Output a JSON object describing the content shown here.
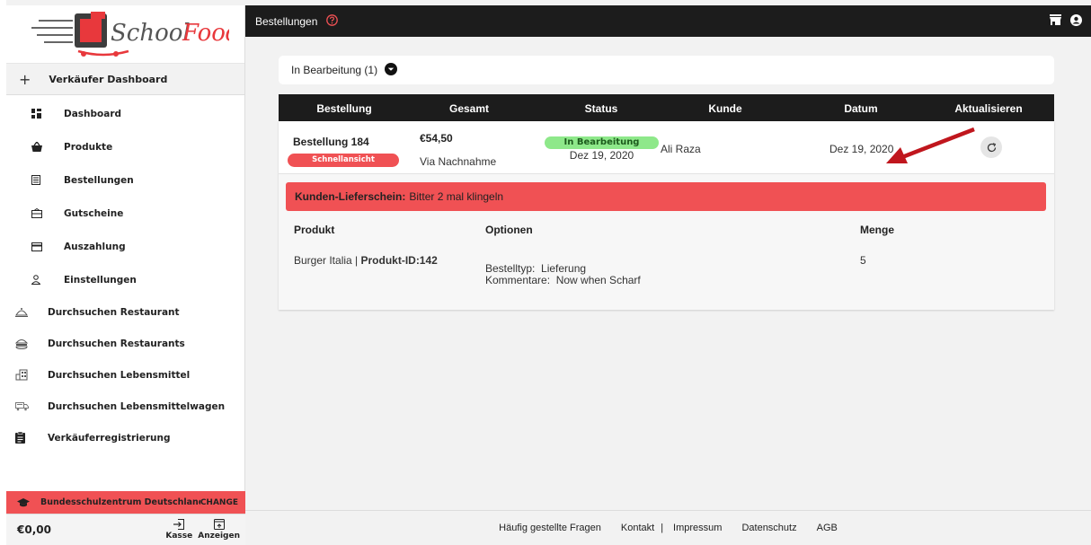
{
  "app": {
    "logo_text": "School Food"
  },
  "sidebar": {
    "header": "Verkäufer Dashboard",
    "sub_items": [
      {
        "label": "Dashboard",
        "icon": "grid-icon"
      },
      {
        "label": "Produkte",
        "icon": "basket-icon"
      },
      {
        "label": "Bestellungen",
        "icon": "list-icon"
      },
      {
        "label": "Gutscheine",
        "icon": "ticket-icon"
      },
      {
        "label": "Auszahlung",
        "icon": "credit-card-icon"
      },
      {
        "label": "Einstellungen",
        "icon": "person-icon"
      }
    ],
    "top_items": [
      {
        "label": "Durchsuchen Restaurant",
        "icon": "cloche-icon"
      },
      {
        "label": "Durchsuchen Restaurants",
        "icon": "burger-icon"
      },
      {
        "label": "Durchsuchen Lebensmittel",
        "icon": "store-icon"
      },
      {
        "label": "Durchsuchen Lebensmittelwagen",
        "icon": "food-truck-icon"
      },
      {
        "label": "Verkäuferregistrierung",
        "icon": "clipboard-icon"
      }
    ],
    "school": {
      "name": "Bundesschulzentrum Deutschland...",
      "change": "CHANGE"
    },
    "balance": "€0,00",
    "checkout": "Kasse",
    "show": "Anzeigen"
  },
  "topbar": {
    "title": "Bestellungen"
  },
  "filter": {
    "label": "In Bearbeitung (1)"
  },
  "table": {
    "columns": [
      "Bestellung",
      "Gesamt",
      "Status",
      "Kunde",
      "Datum",
      "Aktualisieren"
    ]
  },
  "order": {
    "title": "Bestellung 184",
    "quick_view": "Schnellansicht",
    "total": "€54,50",
    "payment": "Via Nachnahme",
    "status": "In Bearbeitung",
    "status_date": "Dez 19, 2020",
    "customer": "Ali Raza",
    "date": "Dez 19, 2020",
    "note_label": "Kunden-Lieferschein:",
    "note_text": "Bitter 2 mal klingeln",
    "product_headers": {
      "product": "Produkt",
      "options": "Optionen",
      "qty": "Menge"
    },
    "product": {
      "name": "Burger Italia | ",
      "id_label": "Produkt-ID:142",
      "order_type": "Bestelltyp:  Lieferung",
      "comment": "Kommentare:  Now when Scharf",
      "qty": "5"
    }
  },
  "footer": {
    "faq": "Häufig gestellte Fragen",
    "contact": "Kontakt",
    "sep": "|",
    "imprint": "Impressum",
    "privacy": "Datenschutz",
    "terms": "AGB"
  },
  "colors": {
    "accent": "#f05154",
    "dark": "#1c1c1c",
    "status_green": "#8ee88a",
    "arrow": "#c0161d"
  }
}
